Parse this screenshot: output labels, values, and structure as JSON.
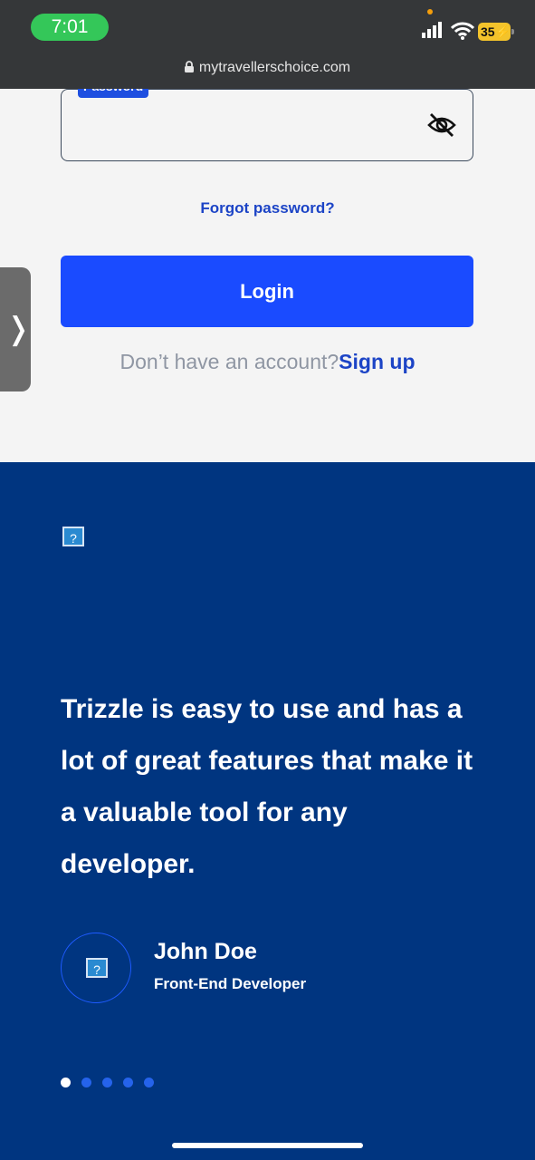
{
  "status_bar": {
    "time": "7:01",
    "battery": "35",
    "url": "mytravellerschoice.com"
  },
  "login": {
    "password_label": "Password",
    "forgot_password": "Forgot password?",
    "login_button": "Login",
    "no_account": "Don’t have an account?",
    "sign_up": "Sign up"
  },
  "side_tab": {
    "glyph": "❭"
  },
  "testimonial": {
    "image_placeholder": "?",
    "quote": "Trizzle is easy to use and has a lot of great features that make it a valuable tool for any developer.",
    "author_name": "John Doe",
    "author_role": "Front-End Developer",
    "avatar_placeholder": "?",
    "slides": {
      "count": 5,
      "active_index": 0
    }
  },
  "colors": {
    "brand_blue": "#1a4bff",
    "link_blue": "#1c44c6",
    "dark_navy": "#003580",
    "status_green": "#34c759"
  }
}
